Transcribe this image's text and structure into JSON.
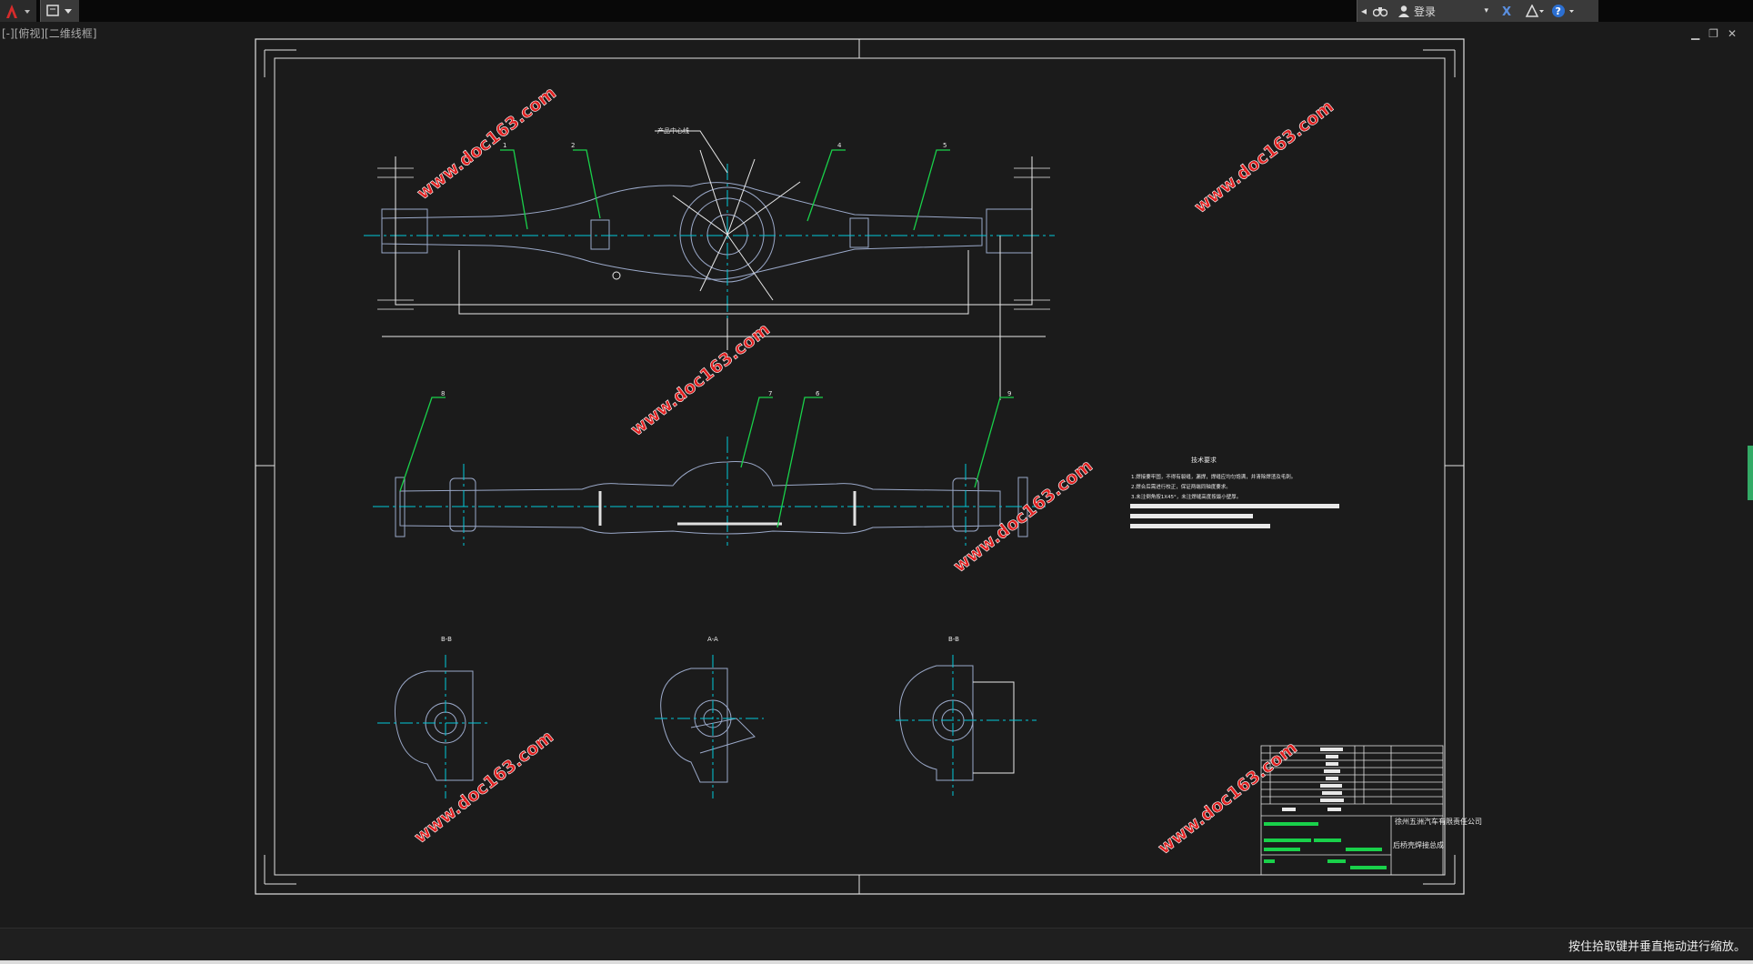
{
  "title_bar": {
    "app_menu_icon": "autocad-logo-icon",
    "login_label": "登录",
    "help_label": "?"
  },
  "viewport": {
    "view_label": "[-][俯视][二维线框]"
  },
  "drawing": {
    "callouts": [
      "1",
      "2",
      "3",
      "4",
      "5",
      "6",
      "7",
      "8",
      "9"
    ],
    "center_label": "产品中心线",
    "section_labels": [
      "B-B",
      "A-A",
      "B-B"
    ],
    "notes_title": "技术要求",
    "notes": [
      "1.焊接要牢固，不得有裂缝，漏焊，焊缝应均匀饱满，并清除焊渣及毛刺。",
      "2.焊合后需进行校正，保证两端同轴度要求。",
      "3.未注倒角按1X45°，未注焊缝高度按最小壁厚。"
    ],
    "title_block": {
      "company": "徐州五洲汽车有限责任公司",
      "part_name": "后桥壳焊接总成",
      "rows": [
        [
          "1",
          "",
          "",
          "1",
          "1"
        ],
        [
          "2",
          "",
          "",
          "1",
          "2"
        ],
        [
          "3",
          "",
          "",
          "1",
          "4"
        ],
        [
          "4",
          "",
          "",
          "1",
          "2"
        ],
        [
          "5",
          "",
          "",
          "1",
          "1"
        ],
        [
          "6",
          "",
          "",
          "1",
          "1"
        ],
        [
          "7",
          "",
          "",
          "1",
          "2"
        ],
        [
          "8",
          "",
          "",
          "1",
          "4"
        ],
        [
          "9",
          "",
          "",
          "1",
          "2"
        ]
      ]
    },
    "watermark": "www.doc163.com"
  },
  "status_bar": {
    "hint": "按住拾取键并垂直拖动进行缩放。"
  },
  "colors": {
    "background": "#1b1b1b",
    "frame": "#e0e0e0",
    "centerline": "#00c8d8",
    "leader": "#19d14a",
    "watermark": "#e02020"
  }
}
